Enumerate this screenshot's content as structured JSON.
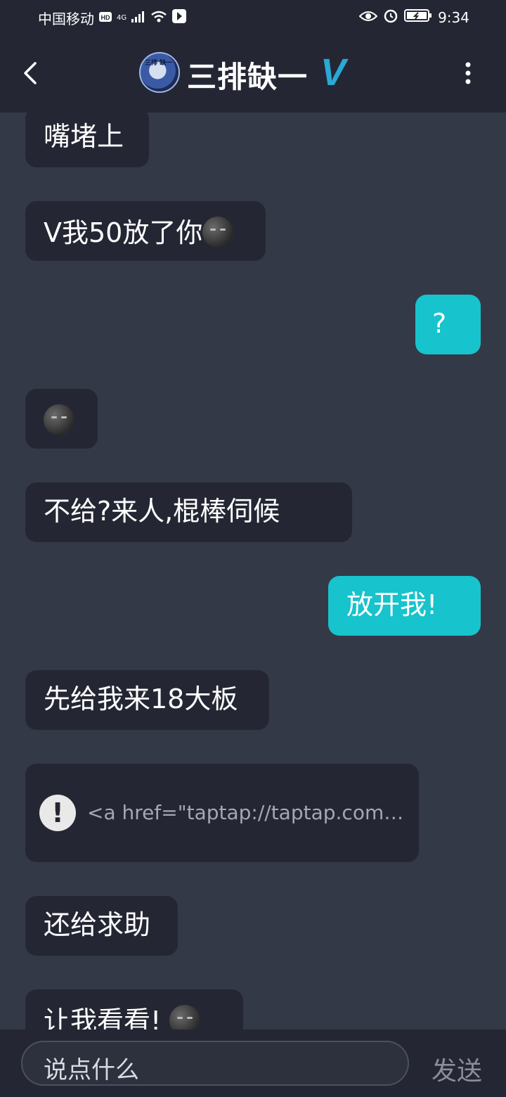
{
  "status_bar": {
    "carrier": "中国移动",
    "network": "4G",
    "time": "9:34"
  },
  "header": {
    "title": "三排缺一",
    "badge": "V",
    "avatar_text": "三排 缺一"
  },
  "messages": [
    {
      "side": "in",
      "text": "嘴堵上"
    },
    {
      "side": "in",
      "text": "V我50放了你",
      "emoji": "smirk-moon"
    },
    {
      "side": "out",
      "text": "?"
    },
    {
      "side": "in",
      "text": "",
      "emoji": "smirk-moon"
    },
    {
      "side": "in",
      "text": "不给?来人,棍棒伺候"
    },
    {
      "side": "out",
      "text": "放开我!"
    },
    {
      "side": "in",
      "text": "先给我来18大板"
    },
    {
      "side": "in",
      "type": "link",
      "text": "<a href=\"taptap://taptap.com…"
    },
    {
      "side": "in",
      "text": "还给求助"
    },
    {
      "side": "in",
      "text": "让我看看!",
      "emoji": "smirk-moon"
    }
  ],
  "input": {
    "placeholder": "说点什么",
    "send_label": "发送"
  },
  "colors": {
    "background": "#343947",
    "bar": "#242733",
    "incoming_bubble": "#242733",
    "outgoing_bubble": "#17c3cc",
    "badge": "#2aa8d6"
  }
}
